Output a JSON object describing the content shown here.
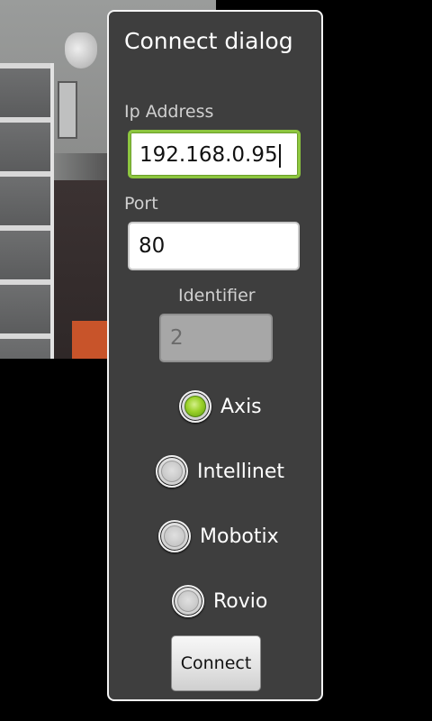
{
  "dialog": {
    "title": "Connect dialog",
    "ip_address": {
      "label": "Ip Address",
      "value": "192.168.0.95"
    },
    "port": {
      "label": "Port",
      "value": "80"
    },
    "identifier": {
      "label": "Identifier",
      "value": "2",
      "enabled": false
    },
    "camera_types": [
      {
        "label": "Axis",
        "checked": true
      },
      {
        "label": "Intellinet",
        "checked": false
      },
      {
        "label": "Mobotix",
        "checked": false
      },
      {
        "label": "Rovio",
        "checked": false
      }
    ],
    "connect_label": "Connect"
  },
  "colors": {
    "accent_green": "#8dc63f",
    "dialog_bg": "#3e3e3e",
    "dialog_border": "#f4f4f4"
  }
}
